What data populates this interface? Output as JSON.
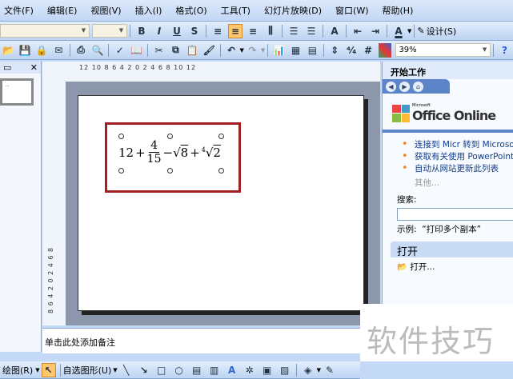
{
  "menu": [
    "文件(F)",
    "编辑(E)",
    "视图(V)",
    "插入(I)",
    "格式(O)",
    "工具(T)",
    "幻灯片放映(D)",
    "窗口(W)",
    "帮助(H)"
  ],
  "format_toolbar": {
    "bold": "B",
    "italic": "I",
    "underline": "U",
    "shadow": "S",
    "design": "设计(S)"
  },
  "standard_toolbar": {
    "zoom": "39%"
  },
  "ruler": {
    "horizontal": "12  10  8  6  4  2  0  2  4  6  8  10  12",
    "vertical": "8  6  4  2  0  2  4  6  8"
  },
  "slide": {
    "eq_whole": "12",
    "eq_num": "4",
    "eq_den": "15",
    "eq_rad1": "8",
    "eq_root_index": "4",
    "eq_rad2": "2"
  },
  "notes": "单击此处添加备注",
  "taskpane": {
    "title": "开始工作",
    "brand_small": "Microsoft",
    "brand": "Office Online",
    "items": [
      "连接到 Micr 转到 Microsoft Office Online",
      "获取有关使用 PowerPoint 的最新新闻",
      "自动从网站更新此列表"
    ],
    "more": "其他...",
    "search_label": "搜索:",
    "search_value": "",
    "example": "示例:  “打印多个副本”",
    "open_section": "打开",
    "open_link": "打开..."
  },
  "draw_toolbar": {
    "draw": "绘图(R)",
    "autoshapes": "自选图形(U)"
  },
  "watermark": "软件技巧"
}
